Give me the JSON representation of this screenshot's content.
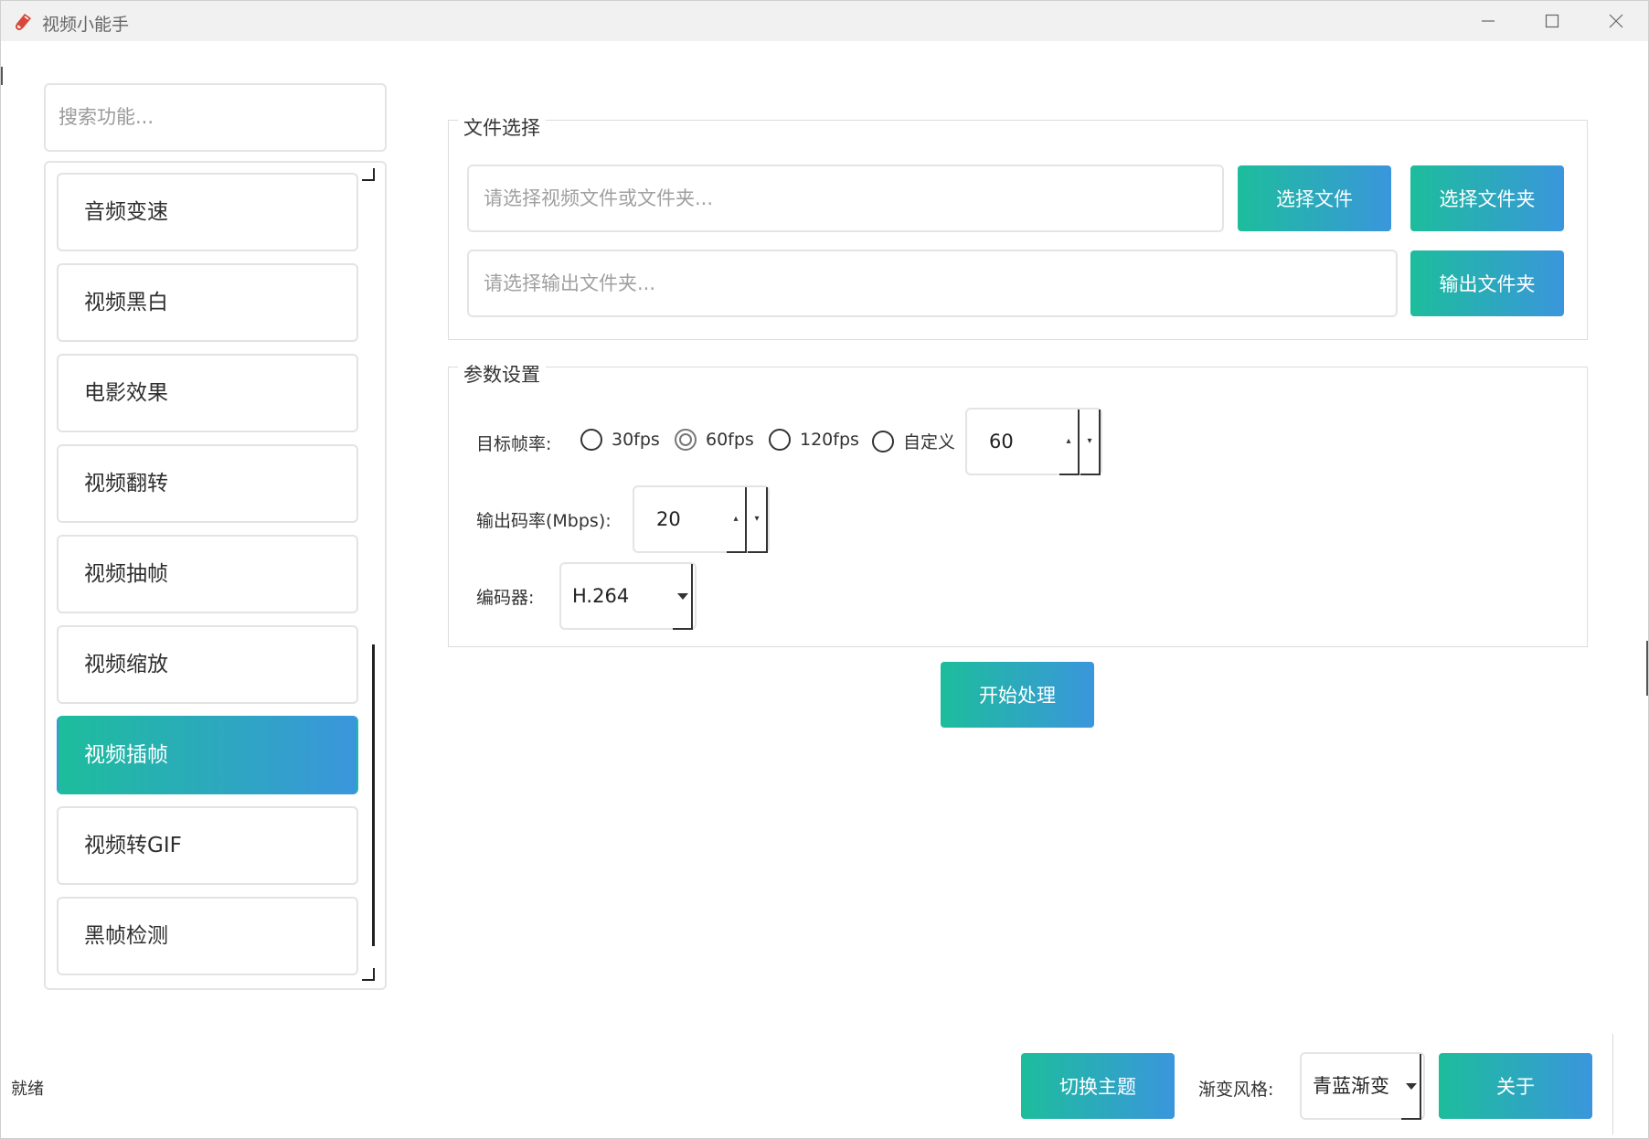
{
  "window": {
    "title": "视频小能手"
  },
  "sidebar": {
    "search_placeholder": "搜索功能...",
    "items": [
      {
        "label": "音频变速"
      },
      {
        "label": "视频黑白"
      },
      {
        "label": "电影效果"
      },
      {
        "label": "视频翻转"
      },
      {
        "label": "视频抽帧"
      },
      {
        "label": "视频缩放"
      },
      {
        "label": "视频插帧",
        "active": true
      },
      {
        "label": "视频转GIF"
      },
      {
        "label": "黑帧检测"
      }
    ]
  },
  "file_group": {
    "title": "文件选择",
    "input_placeholder": "请选择视频文件或文件夹...",
    "select_file_label": "选择文件",
    "select_folder_label": "选择文件夹",
    "output_placeholder": "请选择输出文件夹...",
    "output_folder_label": "输出文件夹"
  },
  "param_group": {
    "title": "参数设置",
    "fps_label": "目标帧率:",
    "fps_options": [
      "30fps",
      "60fps",
      "120fps",
      "自定义"
    ],
    "fps_selected": "60fps",
    "custom_fps_value": "60",
    "bitrate_label": "输出码率(Mbps):",
    "bitrate_value": "20",
    "encoder_label": "编码器:",
    "encoder_value": "H.264"
  },
  "start_button_label": "开始处理",
  "footer": {
    "status": "就绪",
    "theme_button_label": "切换主题",
    "gradient_label": "渐变风格:",
    "gradient_value": "青蓝渐变",
    "about_button_label": "关于"
  },
  "colors": {
    "gradient_start": "#1dbd9c",
    "gradient_end": "#3a96dc"
  }
}
